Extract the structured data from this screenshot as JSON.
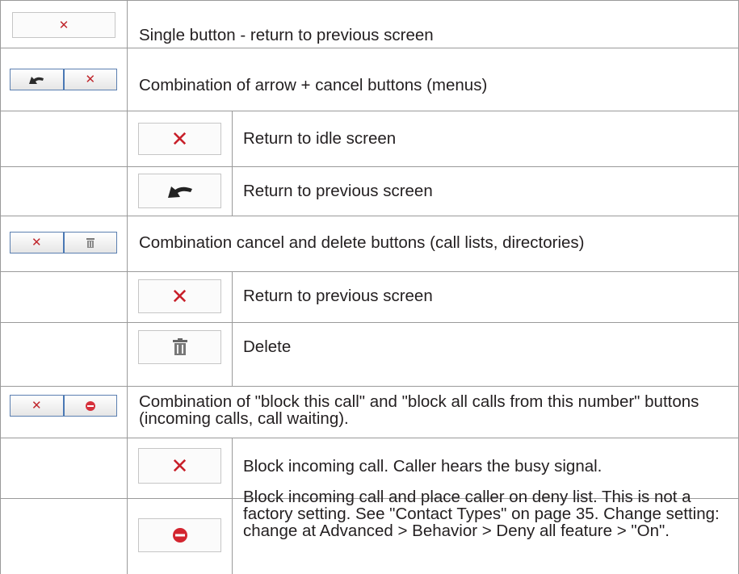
{
  "rows": [
    {
      "id": "single-button",
      "icons": [
        "x-icon"
      ],
      "description": "Single button - return to previous screen"
    },
    {
      "id": "arrow-cancel-combo",
      "icons": [
        "back-arrow-icon",
        "x-icon"
      ],
      "description": "Combination of arrow + cancel buttons (menus)"
    },
    {
      "id": "arrow-cancel-x",
      "icons": [
        "x-icon"
      ],
      "description": "Return to idle screen"
    },
    {
      "id": "arrow-cancel-arrow",
      "icons": [
        "back-arrow-icon"
      ],
      "description": "Return to previous screen"
    },
    {
      "id": "cancel-delete-combo",
      "icons": [
        "x-icon",
        "trash-icon"
      ],
      "description": "Combination cancel and delete buttons (call lists, directories)"
    },
    {
      "id": "cancel-delete-x",
      "icons": [
        "x-icon"
      ],
      "description": "Return to previous screen"
    },
    {
      "id": "cancel-delete-trash",
      "icons": [
        "trash-icon"
      ],
      "description": "Delete"
    },
    {
      "id": "block-combo",
      "icons": [
        "x-icon",
        "no-entry-icon"
      ],
      "description": "Combination of \"block this call\" and \"block all calls from this number\" buttons (incoming calls, call waiting)."
    },
    {
      "id": "block-x",
      "icons": [
        "x-icon"
      ],
      "description": "Block incoming call.  Caller hears the busy signal."
    },
    {
      "id": "block-deny",
      "icons": [
        "no-entry-icon"
      ],
      "description": "Block incoming call and place caller on deny list. This is not a factory setting.  See \"Contact Types\" on page 35.  Change setting:  change at Advanced > Behavior > Deny all feature > \"On\"."
    }
  ],
  "colors": {
    "cancel_red": "#c8202a",
    "combo_blue": "#4a78b4",
    "grid_line": "#9a9a9a"
  }
}
